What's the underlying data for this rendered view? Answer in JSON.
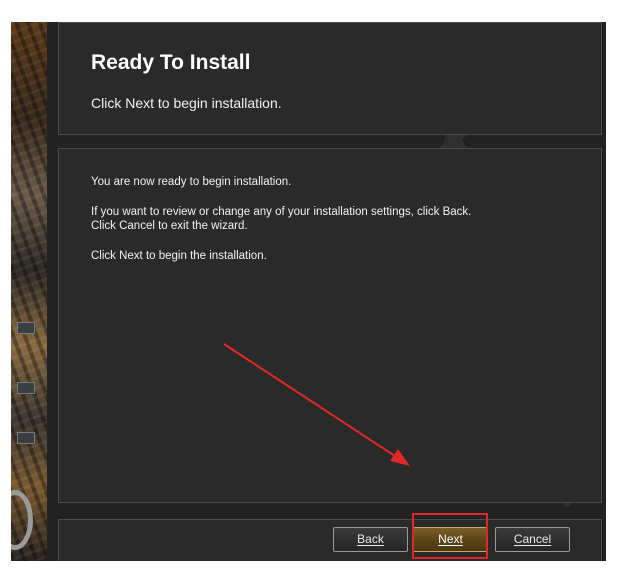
{
  "header": {
    "title": "Ready To Install",
    "subtitle": "Click Next to begin installation."
  },
  "body": {
    "messages": [
      "You are now ready to begin installation.",
      "If you want to review or change any of your installation settings, click Back.",
      "Click Cancel to exit the wizard.",
      "Click Next to begin the installation."
    ]
  },
  "footer": {
    "back_label": "Back",
    "next_label": "Next",
    "cancel_label": "Cancel"
  },
  "colors": {
    "window_bg": "#222222",
    "panel_bg": "#2a2a2a",
    "next_button": "#6b5020",
    "annotation": "#e0282a"
  },
  "icons": [
    "decorative-artwork"
  ]
}
